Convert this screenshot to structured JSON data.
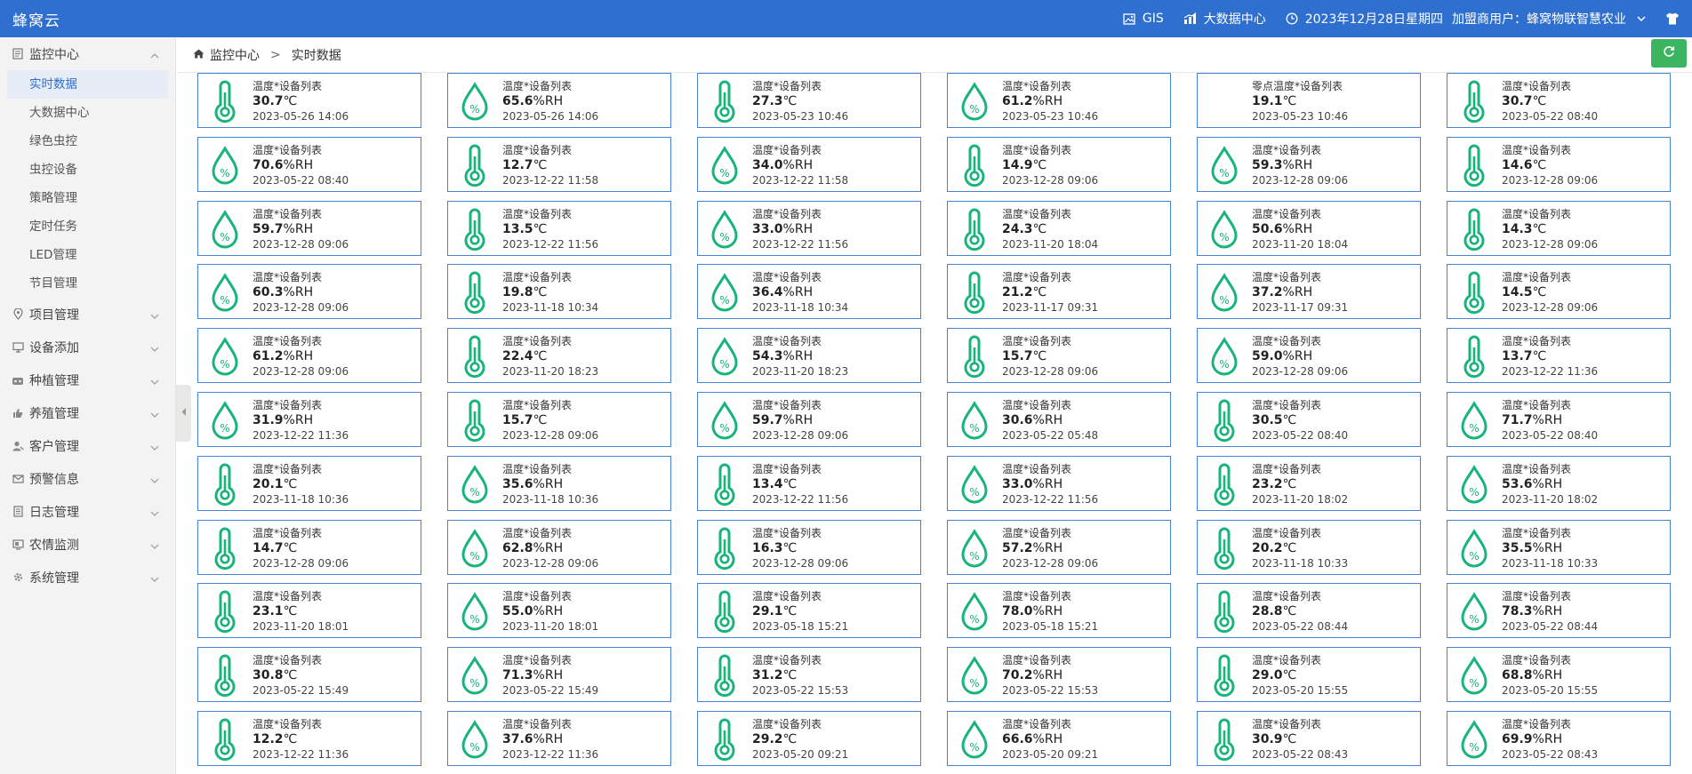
{
  "app": {
    "title": "蜂窝云"
  },
  "topnav": {
    "gis": "GIS",
    "bigdata": "大数据中心",
    "datetime": "2023年12月28日星期四",
    "user": "加盟商用户：蜂窝物联智慧农业"
  },
  "sidebar": {
    "sections": [
      {
        "label": "监控中心",
        "icon": "monitor-icon",
        "expanded": true,
        "items": [
          "实时数据",
          "大数据中心",
          "绿色虫控",
          "虫控设备",
          "策略管理",
          "定时任务",
          "LED管理",
          "节目管理"
        ]
      },
      {
        "label": "项目管理",
        "icon": "location-icon"
      },
      {
        "label": "设备添加",
        "icon": "device-icon"
      },
      {
        "label": "种植管理",
        "icon": "plant-icon"
      },
      {
        "label": "养殖管理",
        "icon": "thumb-icon"
      },
      {
        "label": "客户管理",
        "icon": "customer-icon"
      },
      {
        "label": "预警信息",
        "icon": "mail-icon"
      },
      {
        "label": "日志管理",
        "icon": "log-icon"
      },
      {
        "label": "农情监测",
        "icon": "screen-icon"
      },
      {
        "label": "系统管理",
        "icon": "gear-icon"
      }
    ],
    "active_item": "实时数据"
  },
  "breadcrumb": {
    "home": "监控中心",
    "separator": ">",
    "current": "实时数据"
  },
  "colors": {
    "accent": "#2f6fcf",
    "icon": "#19b47a",
    "border": "#4a82d6",
    "refresh": "#3bb55f"
  },
  "cards": [
    {
      "name": "温度*设备列表",
      "num": "30.7",
      "unit": "℃",
      "time": "2023-05-26 14:06",
      "icon": "thermometer-icon"
    },
    {
      "name": "温度*设备列表",
      "num": "65.6",
      "unit": "%RH",
      "time": "2023-05-26 14:06",
      "icon": "humidity-drop-icon"
    },
    {
      "name": "温度*设备列表",
      "num": "27.3",
      "unit": "℃",
      "time": "2023-05-23 10:46",
      "icon": "thermometer-icon"
    },
    {
      "name": "温度*设备列表",
      "num": "61.2",
      "unit": "%RH",
      "time": "2023-05-23 10:46",
      "icon": "humidity-drop-icon"
    },
    {
      "name": "零点温度*设备列表",
      "num": "19.1",
      "unit": "℃",
      "time": "2023-05-23 10:46",
      "icon": "none"
    },
    {
      "name": "温度*设备列表",
      "num": "30.7",
      "unit": "℃",
      "time": "2023-05-22 08:40",
      "icon": "thermometer-icon"
    },
    {
      "name": "温度*设备列表",
      "num": "70.6",
      "unit": "%RH",
      "time": "2023-05-22 08:40",
      "icon": "humidity-drop-icon"
    },
    {
      "name": "温度*设备列表",
      "num": "12.7",
      "unit": "℃",
      "time": "2023-12-22 11:58",
      "icon": "thermometer-icon"
    },
    {
      "name": "温度*设备列表",
      "num": "34.0",
      "unit": "%RH",
      "time": "2023-12-22 11:58",
      "icon": "humidity-drop-icon"
    },
    {
      "name": "温度*设备列表",
      "num": "14.9",
      "unit": "℃",
      "time": "2023-12-28 09:06",
      "icon": "thermometer-icon"
    },
    {
      "name": "温度*设备列表",
      "num": "59.3",
      "unit": "%RH",
      "time": "2023-12-28 09:06",
      "icon": "humidity-drop-icon"
    },
    {
      "name": "温度*设备列表",
      "num": "14.6",
      "unit": "℃",
      "time": "2023-12-28 09:06",
      "icon": "thermometer-icon"
    },
    {
      "name": "温度*设备列表",
      "num": "59.7",
      "unit": "%RH",
      "time": "2023-12-28 09:06",
      "icon": "humidity-drop-icon"
    },
    {
      "name": "温度*设备列表",
      "num": "13.5",
      "unit": "℃",
      "time": "2023-12-22 11:56",
      "icon": "thermometer-icon"
    },
    {
      "name": "温度*设备列表",
      "num": "33.0",
      "unit": "%RH",
      "time": "2023-12-22 11:56",
      "icon": "humidity-drop-icon"
    },
    {
      "name": "温度*设备列表",
      "num": "24.3",
      "unit": "℃",
      "time": "2023-11-20 18:04",
      "icon": "thermometer-icon"
    },
    {
      "name": "温度*设备列表",
      "num": "50.6",
      "unit": "%RH",
      "time": "2023-11-20 18:04",
      "icon": "humidity-drop-icon"
    },
    {
      "name": "温度*设备列表",
      "num": "14.3",
      "unit": "℃",
      "time": "2023-12-28 09:06",
      "icon": "thermometer-icon"
    },
    {
      "name": "温度*设备列表",
      "num": "60.3",
      "unit": "%RH",
      "time": "2023-12-28 09:06",
      "icon": "humidity-drop-icon"
    },
    {
      "name": "温度*设备列表",
      "num": "19.8",
      "unit": "℃",
      "time": "2023-11-18 10:34",
      "icon": "thermometer-icon"
    },
    {
      "name": "温度*设备列表",
      "num": "36.4",
      "unit": "%RH",
      "time": "2023-11-18 10:34",
      "icon": "humidity-drop-icon"
    },
    {
      "name": "温度*设备列表",
      "num": "21.2",
      "unit": "℃",
      "time": "2023-11-17 09:31",
      "icon": "thermometer-icon"
    },
    {
      "name": "温度*设备列表",
      "num": "37.2",
      "unit": "%RH",
      "time": "2023-11-17 09:31",
      "icon": "humidity-drop-icon"
    },
    {
      "name": "温度*设备列表",
      "num": "14.5",
      "unit": "℃",
      "time": "2023-12-28 09:06",
      "icon": "thermometer-icon"
    },
    {
      "name": "温度*设备列表",
      "num": "61.2",
      "unit": "%RH",
      "time": "2023-12-28 09:06",
      "icon": "humidity-drop-icon"
    },
    {
      "name": "温度*设备列表",
      "num": "22.4",
      "unit": "℃",
      "time": "2023-11-20 18:23",
      "icon": "thermometer-icon"
    },
    {
      "name": "温度*设备列表",
      "num": "54.3",
      "unit": "%RH",
      "time": "2023-11-20 18:23",
      "icon": "humidity-drop-icon"
    },
    {
      "name": "温度*设备列表",
      "num": "15.7",
      "unit": "℃",
      "time": "2023-12-28 09:06",
      "icon": "thermometer-icon"
    },
    {
      "name": "温度*设备列表",
      "num": "59.0",
      "unit": "%RH",
      "time": "2023-12-28 09:06",
      "icon": "humidity-drop-icon"
    },
    {
      "name": "温度*设备列表",
      "num": "13.7",
      "unit": "℃",
      "time": "2023-12-22 11:36",
      "icon": "thermometer-icon"
    },
    {
      "name": "温度*设备列表",
      "num": "31.9",
      "unit": "%RH",
      "time": "2023-12-22 11:36",
      "icon": "humidity-drop-icon"
    },
    {
      "name": "温度*设备列表",
      "num": "15.7",
      "unit": "℃",
      "time": "2023-12-28 09:06",
      "icon": "thermometer-icon"
    },
    {
      "name": "温度*设备列表",
      "num": "59.7",
      "unit": "%RH",
      "time": "2023-12-28 09:06",
      "icon": "humidity-drop-icon"
    },
    {
      "name": "温度*设备列表",
      "num": "30.6",
      "unit": "%RH",
      "time": "2023-05-22 05:48",
      "icon": "humidity-drop-icon"
    },
    {
      "name": "温度*设备列表",
      "num": "30.5",
      "unit": "℃",
      "time": "2023-05-22 08:40",
      "icon": "thermometer-icon"
    },
    {
      "name": "温度*设备列表",
      "num": "71.7",
      "unit": "%RH",
      "time": "2023-05-22 08:40",
      "icon": "humidity-drop-icon"
    },
    {
      "name": "温度*设备列表",
      "num": "20.1",
      "unit": "℃",
      "time": "2023-11-18 10:36",
      "icon": "thermometer-icon"
    },
    {
      "name": "温度*设备列表",
      "num": "35.6",
      "unit": "%RH",
      "time": "2023-11-18 10:36",
      "icon": "humidity-drop-icon"
    },
    {
      "name": "温度*设备列表",
      "num": "13.4",
      "unit": "℃",
      "time": "2023-12-22 11:56",
      "icon": "thermometer-icon"
    },
    {
      "name": "温度*设备列表",
      "num": "33.0",
      "unit": "%RH",
      "time": "2023-12-22 11:56",
      "icon": "humidity-drop-icon"
    },
    {
      "name": "温度*设备列表",
      "num": "23.2",
      "unit": "℃",
      "time": "2023-11-20 18:02",
      "icon": "thermometer-icon"
    },
    {
      "name": "温度*设备列表",
      "num": "53.6",
      "unit": "%RH",
      "time": "2023-11-20 18:02",
      "icon": "humidity-drop-icon"
    },
    {
      "name": "温度*设备列表",
      "num": "14.7",
      "unit": "℃",
      "time": "2023-12-28 09:06",
      "icon": "thermometer-icon"
    },
    {
      "name": "温度*设备列表",
      "num": "62.8",
      "unit": "%RH",
      "time": "2023-12-28 09:06",
      "icon": "humidity-drop-icon"
    },
    {
      "name": "温度*设备列表",
      "num": "16.3",
      "unit": "℃",
      "time": "2023-12-28 09:06",
      "icon": "thermometer-icon"
    },
    {
      "name": "温度*设备列表",
      "num": "57.2",
      "unit": "%RH",
      "time": "2023-12-28 09:06",
      "icon": "humidity-drop-icon"
    },
    {
      "name": "温度*设备列表",
      "num": "20.2",
      "unit": "℃",
      "time": "2023-11-18 10:33",
      "icon": "thermometer-icon"
    },
    {
      "name": "温度*设备列表",
      "num": "35.5",
      "unit": "%RH",
      "time": "2023-11-18 10:33",
      "icon": "humidity-drop-icon"
    },
    {
      "name": "温度*设备列表",
      "num": "23.1",
      "unit": "℃",
      "time": "2023-11-20 18:01",
      "icon": "thermometer-icon"
    },
    {
      "name": "温度*设备列表",
      "num": "55.0",
      "unit": "%RH",
      "time": "2023-11-20 18:01",
      "icon": "humidity-drop-icon"
    },
    {
      "name": "温度*设备列表",
      "num": "29.1",
      "unit": "℃",
      "time": "2023-05-18 15:21",
      "icon": "thermometer-icon"
    },
    {
      "name": "温度*设备列表",
      "num": "78.0",
      "unit": "%RH",
      "time": "2023-05-18 15:21",
      "icon": "humidity-drop-icon"
    },
    {
      "name": "温度*设备列表",
      "num": "28.8",
      "unit": "℃",
      "time": "2023-05-22 08:44",
      "icon": "thermometer-icon"
    },
    {
      "name": "温度*设备列表",
      "num": "78.3",
      "unit": "%RH",
      "time": "2023-05-22 08:44",
      "icon": "humidity-drop-icon"
    },
    {
      "name": "温度*设备列表",
      "num": "30.8",
      "unit": "℃",
      "time": "2023-05-22 15:49",
      "icon": "thermometer-icon"
    },
    {
      "name": "温度*设备列表",
      "num": "71.3",
      "unit": "%RH",
      "time": "2023-05-22 15:49",
      "icon": "humidity-drop-icon"
    },
    {
      "name": "温度*设备列表",
      "num": "31.2",
      "unit": "℃",
      "time": "2023-05-22 15:53",
      "icon": "thermometer-icon"
    },
    {
      "name": "温度*设备列表",
      "num": "70.2",
      "unit": "%RH",
      "time": "2023-05-22 15:53",
      "icon": "humidity-drop-icon"
    },
    {
      "name": "温度*设备列表",
      "num": "29.0",
      "unit": "℃",
      "time": "2023-05-20 15:55",
      "icon": "thermometer-icon"
    },
    {
      "name": "温度*设备列表",
      "num": "68.8",
      "unit": "%RH",
      "time": "2023-05-20 15:55",
      "icon": "humidity-drop-icon"
    },
    {
      "name": "温度*设备列表",
      "num": "12.2",
      "unit": "℃",
      "time": "2023-12-22 11:36",
      "icon": "thermometer-icon"
    },
    {
      "name": "温度*设备列表",
      "num": "37.6",
      "unit": "%RH",
      "time": "2023-12-22 11:36",
      "icon": "humidity-drop-icon"
    },
    {
      "name": "温度*设备列表",
      "num": "29.2",
      "unit": "℃",
      "time": "2023-05-20 09:21",
      "icon": "thermometer-icon"
    },
    {
      "name": "温度*设备列表",
      "num": "66.6",
      "unit": "%RH",
      "time": "2023-05-20 09:21",
      "icon": "humidity-drop-icon"
    },
    {
      "name": "温度*设备列表",
      "num": "30.9",
      "unit": "℃",
      "time": "2023-05-22 08:43",
      "icon": "thermometer-icon"
    },
    {
      "name": "温度*设备列表",
      "num": "69.9",
      "unit": "%RH",
      "time": "2023-05-22 08:43",
      "icon": "humidity-drop-icon"
    }
  ]
}
